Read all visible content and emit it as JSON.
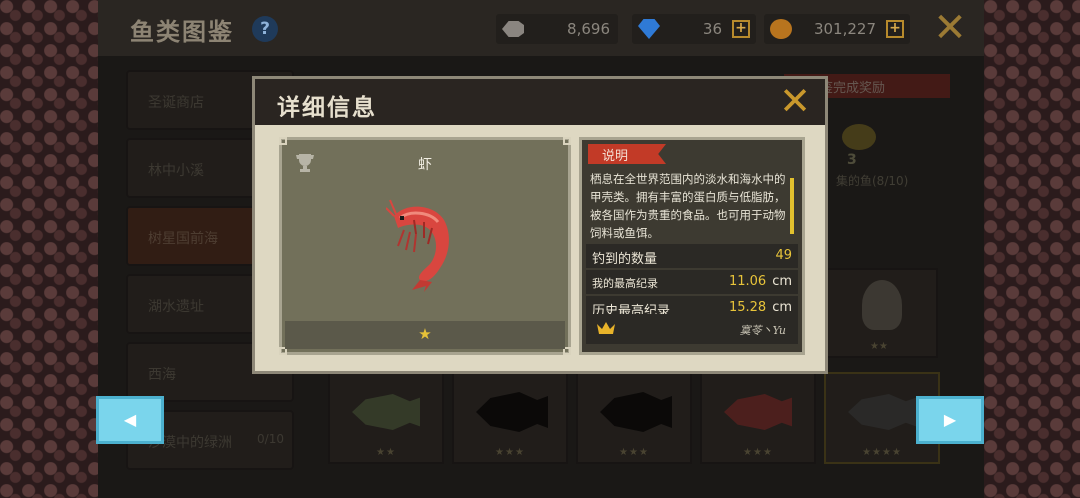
{
  "header": {
    "title": "鱼类图鉴",
    "help_label": "?",
    "fish_count": "8,696",
    "gems": "36",
    "coins": "301,227",
    "plus": "+",
    "close": "✕"
  },
  "sidebar": {
    "items": [
      {
        "label": "圣诞商店"
      },
      {
        "label": "林中小溪"
      },
      {
        "label": "树星国前海"
      },
      {
        "label": "湖水遗址"
      },
      {
        "label": "西海"
      },
      {
        "label": "沙漠中的绿洲",
        "count": "0/10"
      }
    ]
  },
  "reward": {
    "banner": "鉴完成奖励",
    "amount": "3",
    "caption": "集的鱼(8/10)"
  },
  "cards": {
    "stars": [
      "★★",
      "★★★",
      "★★★",
      "★★★",
      "★★★★"
    ],
    "octopus_stars": "★★"
  },
  "nav": {
    "prev": "◀",
    "next": "▶"
  },
  "modal": {
    "title": "详细信息",
    "close": "✕",
    "fish_name": "虾",
    "rarity_stars": "★",
    "description_tag": "说明",
    "description": "栖息在全世界范围内的淡水和海水中的甲壳类。拥有丰富的蛋白质与低脂肪，被各国作为贵重的食品。也可用于动物饲料或鱼饵。",
    "stats": {
      "caught_label": "钓到的数量",
      "caught_value": "49",
      "my_record_label": "我的最高纪录",
      "my_record_value": "11.06",
      "history_record_label": "历史最高纪录",
      "history_record_value": "15.28",
      "unit": "cm"
    },
    "record_holder": "寞苓丶Yu"
  },
  "colors": {
    "accent_gold": "#e8c43a",
    "tag_red": "#c23a27",
    "nav_cyan": "#7ad5ec"
  }
}
